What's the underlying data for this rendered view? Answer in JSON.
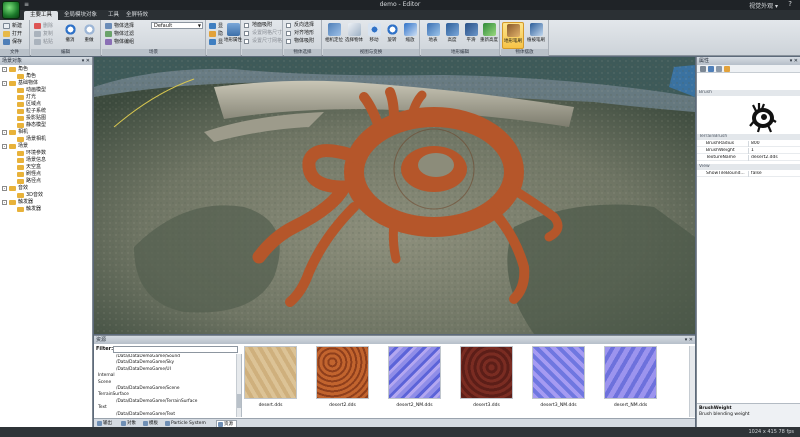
{
  "window": {
    "title": "demo - Editor",
    "quick_access": "≡",
    "right_text": "视觉外观 ▾",
    "help_icon": "help-icon"
  },
  "ribbon_tabs": [
    "主要工具",
    "全局模块对象",
    "工具",
    "全屏特效"
  ],
  "ribbon": {
    "group1": {
      "label": "文件",
      "buttons": [
        "新建",
        "打开",
        "保存"
      ]
    },
    "group2": {
      "label": "编辑",
      "buttons": [
        "删除",
        "复制",
        "粘贴",
        "撤消",
        "重做"
      ]
    },
    "group3": {
      "label": "场景",
      "mode_label": "物体选择",
      "mode_value": "Default",
      "buttons": [
        "物体选择",
        "物体过滤",
        "物体编组"
      ]
    },
    "group4": {
      "label": "",
      "buttons": [
        "显",
        "隐",
        "显"
      ],
      "big_label": "地形属性"
    },
    "group5": {
      "label": "",
      "checks": [
        "地面吸附",
        "设置网格尺寸",
        "设置尺寸网格"
      ]
    },
    "group6": {
      "label": "物体选择",
      "checks": [
        "反向选择",
        "对齐地形",
        "物体吸附"
      ]
    },
    "group7": {
      "label": "视图与变换",
      "big": [
        "相机定位",
        "选择物体",
        "移动",
        "旋转",
        "缩放"
      ]
    },
    "group8": {
      "label": "地形编辑",
      "big": [
        "地表",
        "高度",
        "平滑",
        "重新高度"
      ]
    },
    "group9": {
      "label": "物体摆放",
      "big": [
        "地形笔刷",
        "植被笔刷"
      ]
    }
  },
  "left_panel": {
    "title": "场景对象",
    "tree": [
      {
        "level": 0,
        "exp": "-",
        "label": "角色",
        "color": "#e8b23a"
      },
      {
        "level": 1,
        "exp": "",
        "label": "角色",
        "color": "#e8b23a"
      },
      {
        "level": 0,
        "exp": "-",
        "label": "基础物体",
        "color": "#e8b23a"
      },
      {
        "level": 1,
        "exp": "",
        "label": "动画模型",
        "color": "#e8b23a"
      },
      {
        "level": 1,
        "exp": "",
        "label": "灯光",
        "color": "#e8b23a"
      },
      {
        "level": 1,
        "exp": "",
        "label": "区域点",
        "color": "#e8b23a"
      },
      {
        "level": 1,
        "exp": "",
        "label": "粒子系统",
        "color": "#e8b23a"
      },
      {
        "level": 1,
        "exp": "",
        "label": "投影贴图",
        "color": "#e8b23a"
      },
      {
        "level": 1,
        "exp": "",
        "label": "静态模型",
        "color": "#e8b23a"
      },
      {
        "level": 0,
        "exp": "-",
        "label": "相机",
        "color": "#e8b23a"
      },
      {
        "level": 1,
        "exp": "",
        "label": "场景相机",
        "color": "#e8b23a"
      },
      {
        "level": 0,
        "exp": "-",
        "label": "场景",
        "color": "#e8b23a"
      },
      {
        "level": 1,
        "exp": "",
        "label": "环境参数",
        "color": "#e8b23a"
      },
      {
        "level": 1,
        "exp": "",
        "label": "场景信息",
        "color": "#e8b23a"
      },
      {
        "level": 1,
        "exp": "",
        "label": "天空盒",
        "color": "#e8b23a"
      },
      {
        "level": 1,
        "exp": "",
        "label": "刷怪点",
        "color": "#e8b23a"
      },
      {
        "level": 1,
        "exp": "",
        "label": "路径点",
        "color": "#e8b23a"
      },
      {
        "level": 0,
        "exp": "-",
        "label": "音效",
        "color": "#e8b23a"
      },
      {
        "level": 1,
        "exp": "",
        "label": "3D音效",
        "color": "#e8b23a"
      },
      {
        "level": 0,
        "exp": "-",
        "label": "触发器",
        "color": "#e8b23a"
      },
      {
        "level": 1,
        "exp": "",
        "label": "触发器",
        "color": "#e8b23a"
      }
    ]
  },
  "right_panel": {
    "title": "属性",
    "brush_category": "Brush",
    "terrain_category": "TerrainBrush",
    "props": [
      {
        "k": "BrushRadius",
        "v": "800"
      },
      {
        "k": "BrushWeight",
        "v": "1"
      },
      {
        "k": "TextureName",
        "v": "desert2.dds"
      }
    ],
    "view_category": "View",
    "view_props": [
      {
        "k": "ShowTileBound...",
        "v": "false"
      }
    ],
    "desc_title": "BrushWeight",
    "desc_text": "Brush blending weight"
  },
  "bottom_panel": {
    "title": "资源",
    "filter_label": "Filter:",
    "files": [
      "/Data/DataDemoGame/Sound",
      "/Data/DataDemoGame/Sky",
      "/Data/DataDemoGame/UI",
      "Internal",
      "Scene",
      "/Data/DataDemoGame/Scene",
      "TerrainSurface",
      "/Data/DataDemoGame/TerrainSurface",
      "Text",
      "/Data/DataDemoGame/Text"
    ],
    "textures": [
      {
        "name": "desert.dds",
        "kind": "sand"
      },
      {
        "name": "desert2.dds",
        "kind": "rock"
      },
      {
        "name": "desert2_NM.dds",
        "kind": "normal"
      },
      {
        "name": "desert3.dds",
        "kind": "red"
      },
      {
        "name": "desert3_NM.dds",
        "kind": "normal2"
      },
      {
        "name": "desert_NM.dds",
        "kind": "normal3"
      }
    ]
  },
  "bottom_tabs": [
    {
      "label": "输出",
      "active": false
    },
    {
      "label": "对象",
      "active": false
    },
    {
      "label": "模板",
      "active": false
    },
    {
      "label": "Particle System",
      "active": false
    },
    {
      "label": "资源",
      "active": true
    }
  ],
  "status": {
    "left": "",
    "right": "1024 x 415 78 fps"
  },
  "colors": {
    "accent": "#f6c347",
    "ribbon_bg": "#dfe3e7",
    "titlebar": "#1f2327",
    "terrain_red": "#b5562a"
  }
}
